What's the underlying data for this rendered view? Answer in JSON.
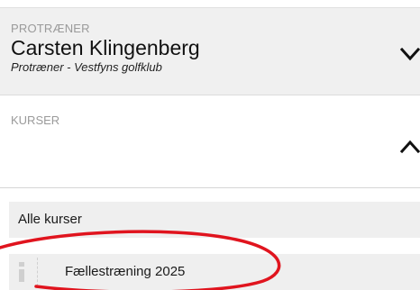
{
  "coach": {
    "label": "PROTRÆNER",
    "name": "Carsten Klingenberg",
    "subtitle": "Protræner - Vestfyns golfklub",
    "toggle_icon": "chevron-down-icon"
  },
  "courses": {
    "label": "KURSER",
    "toggle_icon": "chevron-up-icon",
    "all_label": "Alle kurser",
    "items": [
      {
        "label": "Fællestræning 2025",
        "icon": "info-icon"
      }
    ]
  },
  "colors": {
    "annotation_red": "#e0141e",
    "section_bg": "#f0f0f0",
    "row_bg": "#efefef",
    "label_gray": "#9a9a9a"
  }
}
